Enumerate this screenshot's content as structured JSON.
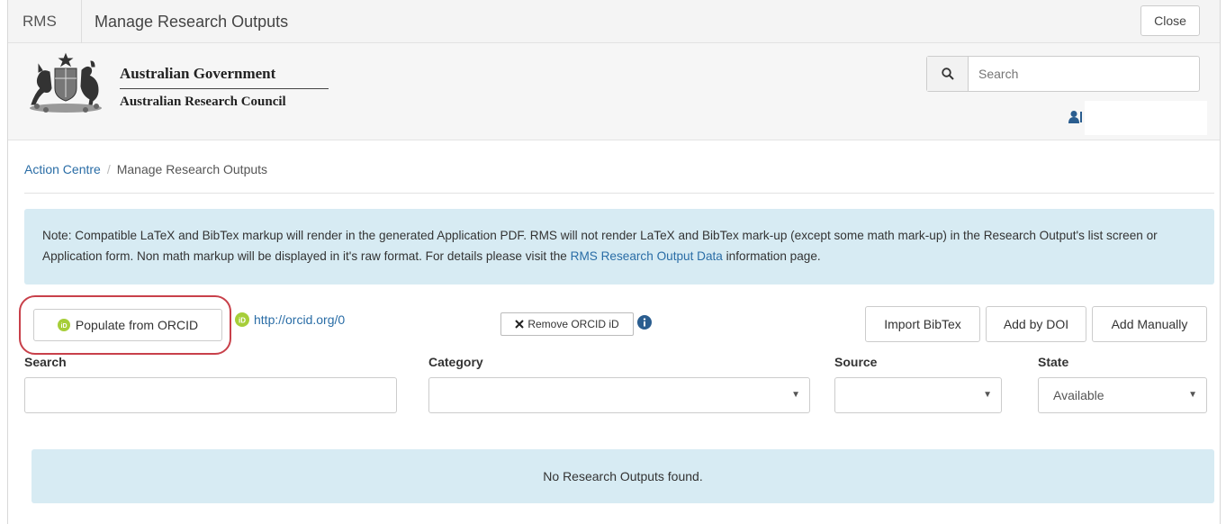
{
  "topbar": {
    "brand": "RMS",
    "title": "Manage Research Outputs",
    "close_label": "Close"
  },
  "header": {
    "gov_line1": "Australian Government",
    "gov_line2": "Australian Research Council",
    "search_placeholder": "Search"
  },
  "breadcrumb": {
    "home": "Action Centre",
    "current": "Manage Research Outputs"
  },
  "note": {
    "text_before": "Note: Compatible LaTeX and BibTex markup will render in the generated Application PDF. RMS will not render LaTeX and BibTex mark-up (except some math mark-up) in the Research Output's list screen or Application form. Non math markup will be displayed in it's raw format. For details please visit the ",
    "link": "RMS Research Output Data",
    "text_after": " information page."
  },
  "actions": {
    "populate": "Populate from ORCID",
    "orcid_url": "http://orcid.org/0",
    "remove": "Remove ORCID iD",
    "import_bibtex": "Import BibTex",
    "add_doi": "Add by DOI",
    "add_manual": "Add Manually"
  },
  "filters": {
    "search_label": "Search",
    "category_label": "Category",
    "category_value": "",
    "source_label": "Source",
    "source_value": "",
    "state_label": "State",
    "state_value": "Available"
  },
  "results": {
    "empty_message": "No Research Outputs found."
  },
  "colors": {
    "link": "#2a6da6",
    "info_bg": "#d7ebf3",
    "highlight_ring": "#c8404a",
    "orcid_green": "#a6ce39"
  }
}
